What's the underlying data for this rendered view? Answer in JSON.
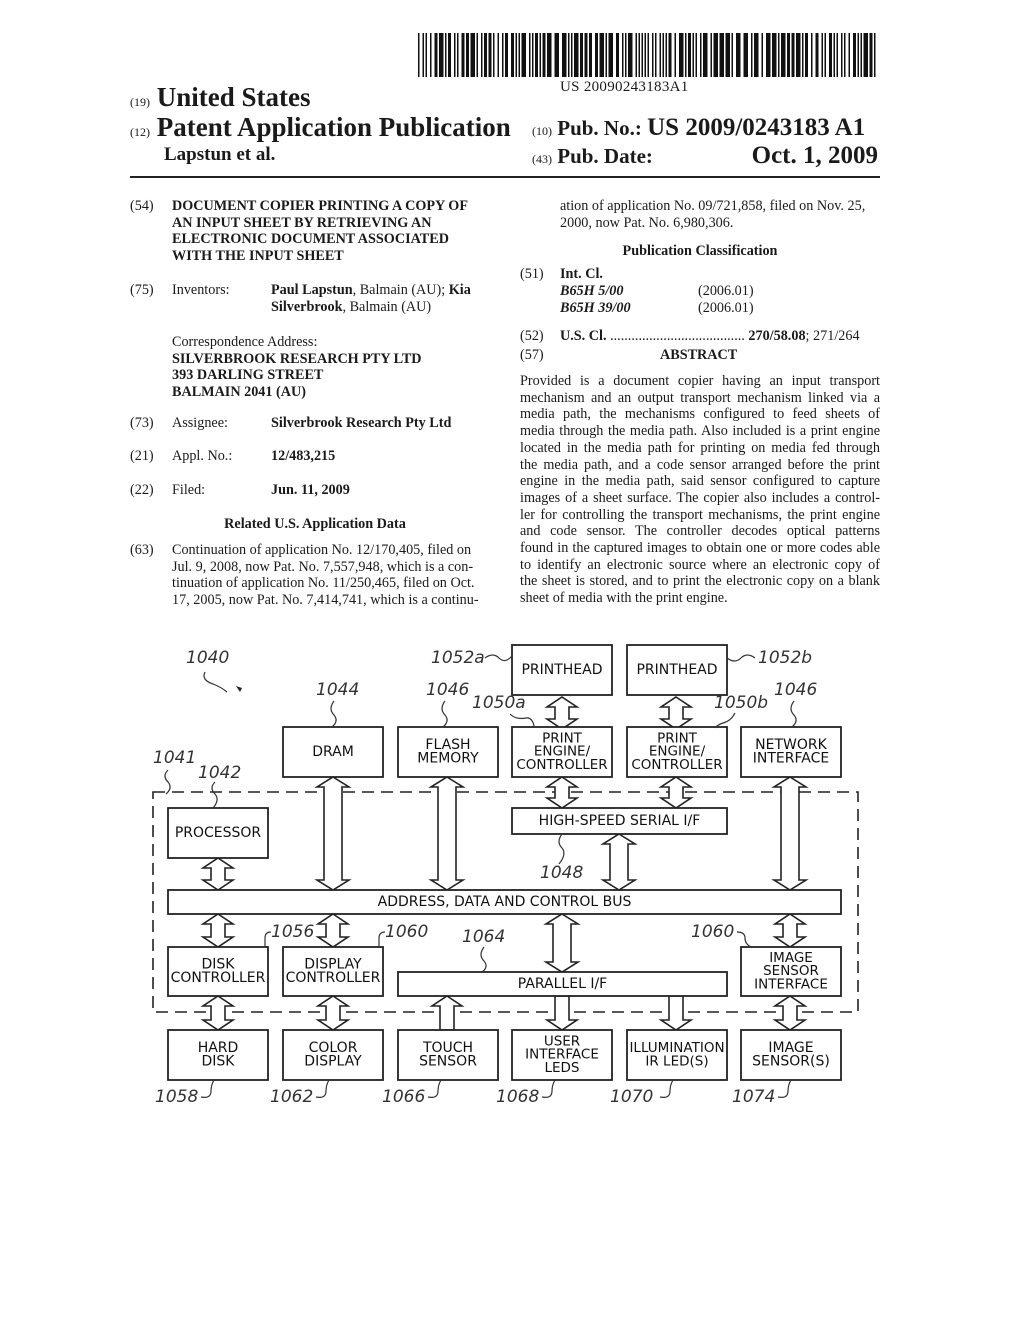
{
  "header": {
    "barcode_number": "US 20090243183A1",
    "country_code": "(19)",
    "country": "United States",
    "type_code": "(12)",
    "type": "Patent Application Publication",
    "inventors_short": "Lapstun et al.",
    "pub_no_code": "(10)",
    "pub_no_label": "Pub. No.:",
    "pub_no": "US 2009/0243183 A1",
    "pub_date_code": "(43)",
    "pub_date_label": "Pub. Date:",
    "pub_date": "Oct. 1, 2009"
  },
  "left_column": {
    "title_code": "(54)",
    "title_lines": [
      "DOCUMENT COPIER PRINTING A COPY OF",
      "AN INPUT SHEET BY RETRIEVING AN",
      "ELECTRONIC DOCUMENT ASSOCIATED",
      "WITH THE INPUT SHEET"
    ],
    "inventors_code": "(75)",
    "inventors_label": "Inventors:",
    "inventor1_name": "Paul Lapstun",
    "inventor1_loc": ", Balmain (AU); ",
    "inventor2_first": "Kia",
    "inventor2_last": "Silverbrook",
    "inventor2_loc": ", Balmain (AU)",
    "correspondence_label": "Correspondence Address:",
    "correspondence_lines": [
      "SILVERBROOK RESEARCH PTY LTD",
      "393 DARLING STREET",
      "BALMAIN 2041 (AU)"
    ],
    "assignee_code": "(73)",
    "assignee_label": "Assignee:",
    "assignee": "Silverbrook Research Pty Ltd",
    "appl_code": "(21)",
    "appl_label": "Appl. No.:",
    "appl_no": "12/483,215",
    "filed_code": "(22)",
    "filed_label": "Filed:",
    "filed": "Jun. 11, 2009",
    "related_title": "Related U.S. Application Data",
    "related_code": "(63)",
    "related_lines": [
      "Continuation of application No. 12/170,405, filed on",
      "Jul. 9, 2008, now Pat. No. 7,557,948, which is a con-",
      "tinuation of application No. 11/250,465, filed on Oct.",
      "17, 2005, now Pat. No. 7,414,741, which is a continu-"
    ]
  },
  "right_column": {
    "continued_lines": [
      "ation of application No. 09/721,858, filed on Nov. 25,",
      "2000, now Pat. No. 6,980,306."
    ],
    "pub_class_title": "Publication Classification",
    "int_cl_code": "(51)",
    "int_cl_label": "Int. Cl.",
    "int_classes": [
      {
        "cls": "B65H 5/00",
        "year": "(2006.01)"
      },
      {
        "cls": "B65H 39/00",
        "year": "(2006.01)"
      }
    ],
    "us_cl_code": "(52)",
    "us_cl_label": "U.S. Cl.",
    "us_cl_dots": "......................................",
    "us_cl_primary": "270/58.08",
    "us_cl_secondary": "; 271/264",
    "abstract_code": "(57)",
    "abstract_title": "ABSTRACT",
    "abstract_lines": [
      "Provided is a document copier having an input transport",
      "mechanism and an output transport mechanism linked via a",
      "media path, the mechanisms configured to feed sheets of",
      "media through the media path. Also included is a print engine",
      "located in the media path for printing on media fed through",
      "the media path, and a code sensor arranged before the print",
      "engine in the media path, said sensor configured to capture",
      "images of a sheet surface. The copier also includes a control-",
      "ler for controlling the transport mechanisms, the print engine",
      "and code sensor. The controller decodes optical patterns",
      "found in the captured images to obtain one or more codes able",
      "to identify an electronic source where an electronic copy of",
      "the sheet is stored, and to print the electronic copy on a blank",
      "sheet of media with the print engine."
    ]
  },
  "figure": {
    "blocks": {
      "printhead_a": [
        "PRINTHEAD"
      ],
      "printhead_b": [
        "PRINTHEAD"
      ],
      "dram": [
        "DRAM"
      ],
      "flash": [
        "FLASH",
        "MEMORY"
      ],
      "pe_a": [
        "PRINT",
        "ENGINE/",
        "CONTROLLER"
      ],
      "pe_b": [
        "PRINT",
        "ENGINE/",
        "CONTROLLER"
      ],
      "network": [
        "NETWORK",
        "INTERFACE"
      ],
      "processor": [
        "PROCESSOR"
      ],
      "hs_serial": [
        "HIGH-SPEED SERIAL I/F"
      ],
      "bus": [
        "ADDRESS, DATA AND CONTROL BUS"
      ],
      "disk_ctrl": [
        "DISK",
        "CONTROLLER"
      ],
      "disp_ctrl": [
        "DISPLAY",
        "CONTROLLER"
      ],
      "parallel": [
        "PARALLEL I/F"
      ],
      "img_if": [
        "IMAGE",
        "SENSOR",
        "INTERFACE"
      ],
      "hard_disk": [
        "HARD",
        "DISK"
      ],
      "color_disp": [
        "COLOR",
        "DISPLAY"
      ],
      "touch": [
        "TOUCH",
        "SENSOR"
      ],
      "ui_leds": [
        "USER",
        "INTERFACE",
        "LEDS"
      ],
      "illum": [
        "ILLUMINATION",
        "IR LED(S)"
      ],
      "img_sensor": [
        "IMAGE",
        "SENSOR(S)"
      ]
    },
    "refs": {
      "r1040": "1040",
      "r1041": "1041",
      "r1042": "1042",
      "r1044": "1044",
      "r1046a": "1046",
      "r1046b": "1046",
      "r1048": "1048",
      "r1050a": "1050a",
      "r1050b": "1050b",
      "r1052a": "1052a",
      "r1052b": "1052b",
      "r1056": "1056",
      "r1060a": "1060",
      "r1060b": "1060",
      "r1064": "1064",
      "r1058": "1058",
      "r1062": "1062",
      "r1066": "1066",
      "r1068": "1068",
      "r1070": "1070",
      "r1074": "1074"
    }
  }
}
